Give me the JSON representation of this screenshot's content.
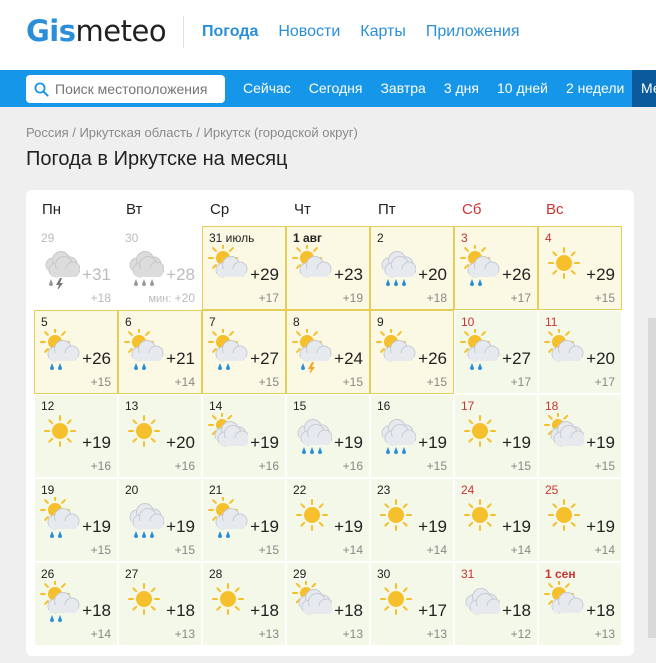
{
  "brand": {
    "name_part1": "Gis",
    "name_part2": "meteo"
  },
  "topnav": [
    {
      "label": "Погода",
      "active": true
    },
    {
      "label": "Новости",
      "active": false
    },
    {
      "label": "Карты",
      "active": false
    },
    {
      "label": "Приложения",
      "active": false
    }
  ],
  "search": {
    "placeholder": "Поиск местоположения"
  },
  "periodnav": [
    "Сейчас",
    "Сегодня",
    "Завтра",
    "3 дня",
    "10 дней",
    "2 недели",
    "Ме"
  ],
  "breadcrumb": "Россия / Иркутская область / Иркутск (городской округ)",
  "title": "Погода в Иркутске на месяц",
  "weekdays": [
    {
      "label": "Пн",
      "weekend": false
    },
    {
      "label": "Вт",
      "weekend": false
    },
    {
      "label": "Ср",
      "weekend": false
    },
    {
      "label": "Чт",
      "weekend": false
    },
    {
      "label": "Пт",
      "weekend": false
    },
    {
      "label": "Сб",
      "weekend": true
    },
    {
      "label": "Вс",
      "weekend": true
    }
  ],
  "min_label": "мин:",
  "days": [
    {
      "date": "29",
      "max": "+31",
      "min": "+18",
      "icon": "storm-cloud-icon",
      "past": true
    },
    {
      "date": "30",
      "max": "+28",
      "min": "+20",
      "icon": "rain-cloud-icon",
      "past": true,
      "min_prefix": true
    },
    {
      "date": "31 июль",
      "max": "+29",
      "min": "+17",
      "icon": "partly-sunny-icon",
      "sel": true
    },
    {
      "date": "1 авг",
      "max": "+23",
      "min": "+19",
      "icon": "partly-sunny-icon",
      "sel": true,
      "bold": true
    },
    {
      "date": "2",
      "max": "+20",
      "min": "+18",
      "icon": "rain-cloud-icon",
      "sel": true
    },
    {
      "date": "3",
      "max": "+26",
      "min": "+17",
      "icon": "sun-rain-icon",
      "sel": true,
      "weekend": true
    },
    {
      "date": "4",
      "max": "+29",
      "min": "+15",
      "icon": "sun-icon",
      "sel": true,
      "weekend": true
    },
    {
      "date": "5",
      "max": "+26",
      "min": "+15",
      "icon": "sun-rain-icon",
      "sel": true
    },
    {
      "date": "6",
      "max": "+21",
      "min": "+14",
      "icon": "sun-rain-icon",
      "sel": true
    },
    {
      "date": "7",
      "max": "+27",
      "min": "+15",
      "icon": "sun-rain-icon",
      "sel": true
    },
    {
      "date": "8",
      "max": "+24",
      "min": "+15",
      "icon": "sun-storm-icon",
      "sel": true
    },
    {
      "date": "9",
      "max": "+26",
      "min": "+15",
      "icon": "partly-sunny-icon",
      "sel": true
    },
    {
      "date": "10",
      "max": "+27",
      "min": "+17",
      "icon": "sun-rain-icon",
      "weekend": true
    },
    {
      "date": "11",
      "max": "+20",
      "min": "+17",
      "icon": "partly-sunny-icon",
      "weekend": true
    },
    {
      "date": "12",
      "max": "+19",
      "min": "+16",
      "icon": "sun-icon"
    },
    {
      "date": "13",
      "max": "+20",
      "min": "+16",
      "icon": "sun-icon"
    },
    {
      "date": "14",
      "max": "+19",
      "min": "+16",
      "icon": "partly-cloudy-icon"
    },
    {
      "date": "15",
      "max": "+19",
      "min": "+16",
      "icon": "cloud-rain-icon"
    },
    {
      "date": "16",
      "max": "+19",
      "min": "+15",
      "icon": "cloud-rain-icon"
    },
    {
      "date": "17",
      "max": "+19",
      "min": "+15",
      "icon": "sun-icon",
      "weekend": true
    },
    {
      "date": "18",
      "max": "+19",
      "min": "+15",
      "icon": "partly-cloudy-icon",
      "weekend": true
    },
    {
      "date": "19",
      "max": "+19",
      "min": "+15",
      "icon": "sun-rain-icon"
    },
    {
      "date": "20",
      "max": "+19",
      "min": "+15",
      "icon": "cloud-rain-icon"
    },
    {
      "date": "21",
      "max": "+19",
      "min": "+15",
      "icon": "sun-rain-icon"
    },
    {
      "date": "22",
      "max": "+19",
      "min": "+14",
      "icon": "sun-icon"
    },
    {
      "date": "23",
      "max": "+19",
      "min": "+14",
      "icon": "sun-icon"
    },
    {
      "date": "24",
      "max": "+19",
      "min": "+14",
      "icon": "sun-icon",
      "weekend": true
    },
    {
      "date": "25",
      "max": "+19",
      "min": "+14",
      "icon": "sun-icon",
      "weekend": true
    },
    {
      "date": "26",
      "max": "+18",
      "min": "+14",
      "icon": "sun-rain-icon"
    },
    {
      "date": "27",
      "max": "+18",
      "min": "+13",
      "icon": "sun-icon"
    },
    {
      "date": "28",
      "max": "+18",
      "min": "+13",
      "icon": "sun-icon"
    },
    {
      "date": "29",
      "max": "+18",
      "min": "+13",
      "icon": "partly-cloudy-icon"
    },
    {
      "date": "30",
      "max": "+17",
      "min": "+13",
      "icon": "sun-icon"
    },
    {
      "date": "31",
      "max": "+18",
      "min": "+12",
      "icon": "cloudy-icon",
      "weekend": true
    },
    {
      "date": "1 сен",
      "max": "+18",
      "min": "+13",
      "icon": "partly-sunny-icon",
      "weekend": true,
      "bold": true
    }
  ]
}
